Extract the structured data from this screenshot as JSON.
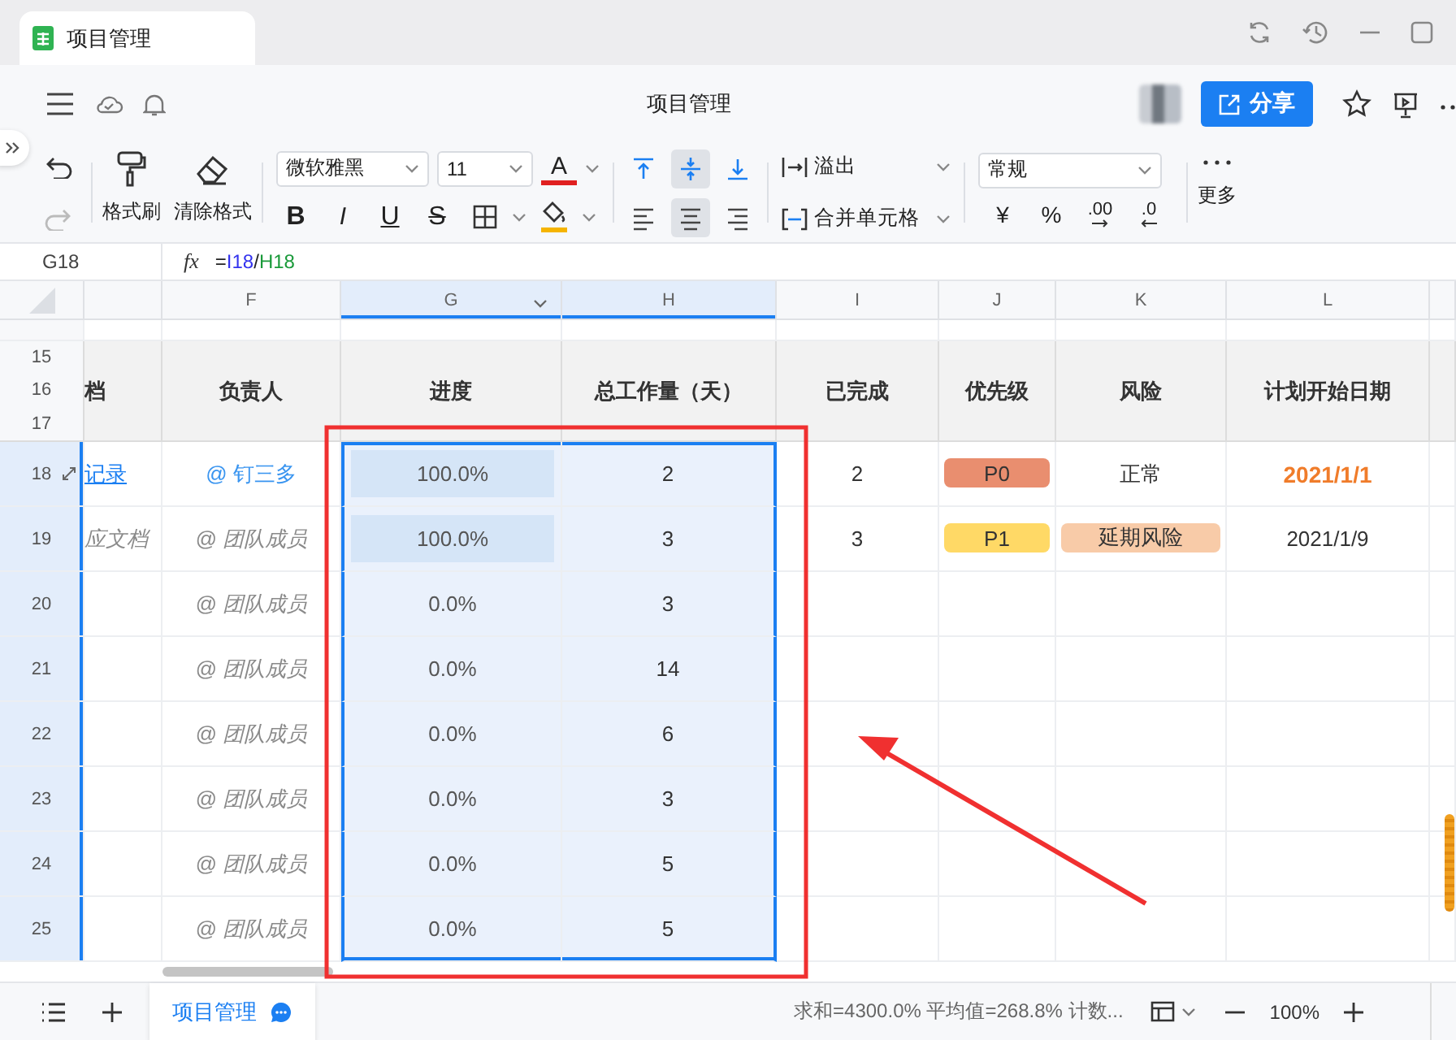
{
  "app_tab": {
    "title": "项目管理"
  },
  "header": {
    "title": "项目管理",
    "share": "分享"
  },
  "toolbar": {
    "format_painter": "格式刷",
    "clear_format": "清除格式",
    "font": "微软雅黑",
    "font_size": "11",
    "text_color": "A",
    "styles": [
      {
        "kind": "bold",
        "label": "B"
      },
      {
        "kind": "italic",
        "label": "I"
      },
      {
        "kind": "underline",
        "label": "U"
      },
      {
        "kind": "strike",
        "label": "S"
      }
    ],
    "vertical_align": [
      {
        "kind": "top",
        "selected": false
      },
      {
        "kind": "middle",
        "selected": true
      },
      {
        "kind": "bottom",
        "selected": false
      }
    ],
    "horizontal_align": [
      {
        "kind": "left",
        "selected": false
      },
      {
        "kind": "center",
        "selected": true
      },
      {
        "kind": "right",
        "selected": false
      }
    ],
    "overflow": "溢出",
    "merge": "合并单元格",
    "number_format": "常规",
    "number_buttons": [
      {
        "kind": "currency",
        "label": "¥"
      },
      {
        "kind": "percent",
        "label": "%"
      },
      {
        "kind": "increase_decimal",
        "label": ".00"
      },
      {
        "kind": "decrease_decimal",
        "label": ".0"
      }
    ],
    "more": "更多"
  },
  "formula_bar": {
    "cell": "G18",
    "fx": "fx",
    "parts": [
      {
        "text": "=",
        "color": "#222222"
      },
      {
        "text": "I18",
        "color": "#3333ee"
      },
      {
        "text": "/",
        "color": "#222222"
      },
      {
        "text": "H18",
        "color": "#1a9a3a"
      }
    ]
  },
  "sheet": {
    "header_rows": [
      "15",
      "16",
      "17"
    ],
    "columns": [
      {
        "header": "档",
        "selected": false
      },
      {
        "letter": "F",
        "header": "负责人",
        "selected": false
      },
      {
        "letter": "G",
        "header": "进度",
        "selected": true
      },
      {
        "letter": "H",
        "header": "总工作量（天）",
        "selected": true
      },
      {
        "letter": "I",
        "header": "已完成",
        "selected": false
      },
      {
        "letter": "J",
        "header": "优先级",
        "selected": false
      },
      {
        "letter": "K",
        "header": "风险",
        "selected": false
      },
      {
        "letter": "L",
        "header": "计划开始日期",
        "selected": false
      },
      {
        "selected": false
      }
    ],
    "rows": [
      {
        "number": "18",
        "selected": true,
        "expandable": true,
        "cells": [
          {
            "kind": "link",
            "text": "记录"
          },
          {
            "kind": "mention",
            "text": "@ 钉三多"
          },
          {
            "kind": "progress",
            "text": "100.0%",
            "level": 1
          },
          {
            "kind": "number",
            "text": "2"
          },
          {
            "kind": "number",
            "text": "2"
          },
          {
            "kind": "tag",
            "text": "P0",
            "color": "#e98e6f"
          },
          {
            "kind": "plain",
            "text": "正常"
          },
          {
            "kind": "highlight",
            "text": "2021/1/1"
          }
        ]
      },
      {
        "number": "19",
        "selected": true,
        "expandable": false,
        "cells": [
          {
            "kind": "hint",
            "text": "应文档"
          },
          {
            "kind": "hint",
            "text": "@ 团队成员"
          },
          {
            "kind": "progress",
            "text": "100.0%",
            "level": 1
          },
          {
            "kind": "number",
            "text": "3"
          },
          {
            "kind": "number",
            "text": "3"
          },
          {
            "kind": "tag",
            "text": "P1",
            "color": "#ffd966"
          },
          {
            "kind": "tag",
            "text": "延期风险",
            "color": "#f8cba8"
          },
          {
            "kind": "plain",
            "text": "2021/1/9"
          }
        ]
      },
      {
        "number": "20",
        "selected": true,
        "expandable": false,
        "cells": [
          {
            "kind": "empty"
          },
          {
            "kind": "hint",
            "text": "@ 团队成员"
          },
          {
            "kind": "progress",
            "text": "0.0%"
          },
          {
            "kind": "number",
            "text": "3"
          }
        ]
      },
      {
        "number": "21",
        "selected": true,
        "expandable": false,
        "cells": [
          {
            "kind": "empty"
          },
          {
            "kind": "hint",
            "text": "@ 团队成员"
          },
          {
            "kind": "progress",
            "text": "0.0%"
          },
          {
            "kind": "number",
            "text": "14"
          }
        ]
      },
      {
        "number": "22",
        "selected": true,
        "expandable": false,
        "cells": [
          {
            "kind": "empty"
          },
          {
            "kind": "hint",
            "text": "@ 团队成员"
          },
          {
            "kind": "progress",
            "text": "0.0%"
          },
          {
            "kind": "number",
            "text": "6"
          }
        ]
      },
      {
        "number": "23",
        "selected": true,
        "expandable": false,
        "cells": [
          {
            "kind": "empty"
          },
          {
            "kind": "hint",
            "text": "@ 团队成员"
          },
          {
            "kind": "progress",
            "text": "0.0%"
          },
          {
            "kind": "number",
            "text": "3"
          }
        ]
      },
      {
        "number": "24",
        "selected": true,
        "expandable": false,
        "cells": [
          {
            "kind": "empty"
          },
          {
            "kind": "hint",
            "text": "@ 团队成员"
          },
          {
            "kind": "progress",
            "text": "0.0%"
          },
          {
            "kind": "number",
            "text": "5"
          }
        ]
      },
      {
        "number": "25",
        "selected": true,
        "expandable": false,
        "cells": [
          {
            "kind": "empty"
          },
          {
            "kind": "hint",
            "text": "@ 团队成员"
          },
          {
            "kind": "progress",
            "text": "0.0%"
          },
          {
            "kind": "number",
            "text": "5"
          }
        ]
      }
    ],
    "annotations": {
      "rectangle": true,
      "arrow": true
    }
  },
  "status_bar": {
    "sheet_tabs": [
      {
        "label": "项目管理",
        "selected": true
      }
    ],
    "summary": "求和=4300.0% 平均值=268.8% 计数...",
    "zoom": "100%"
  }
}
